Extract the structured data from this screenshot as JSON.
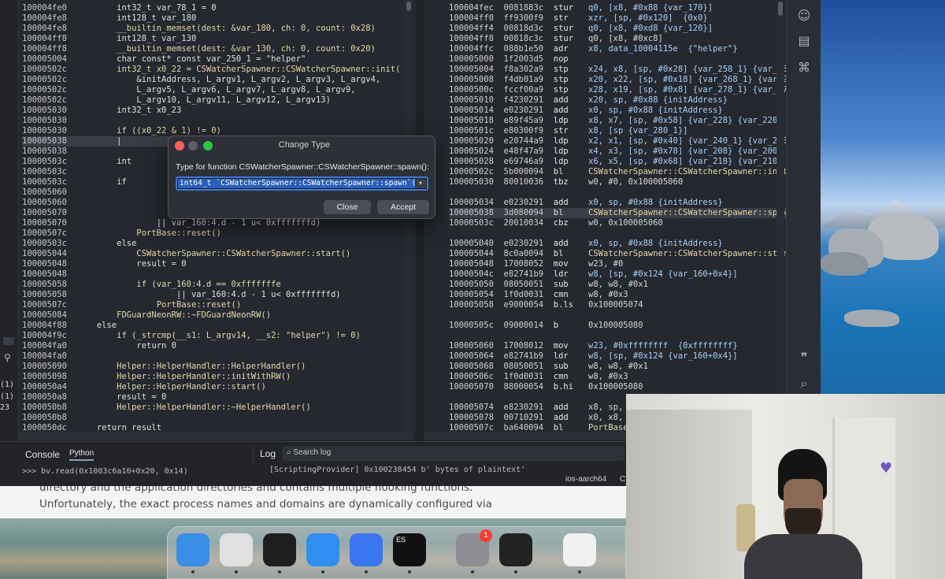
{
  "left_code": [
    {
      "addr": "100004fe0",
      "text": "        int32_t var_78_1 = 0"
    },
    {
      "addr": "100004fe8",
      "text": "        int128_t var_180"
    },
    {
      "addr": "100004fe8",
      "text": "        __builtin_memset(dest: &var_180, ch: 0, count: 0x28)"
    },
    {
      "addr": "100004ff8",
      "text": "        int128_t var_130"
    },
    {
      "addr": "100004ff8",
      "text": "        __builtin_memset(dest: &var_130, ch: 0, count: 0x20)"
    },
    {
      "addr": "100005004",
      "text": "        char const* const var_250_1 = \"helper\""
    },
    {
      "addr": "10000502c",
      "text": "        int32_t x0_22 = CSWatcherSpawner::CSWatcherSpawner::init("
    },
    {
      "addr": "10000502c",
      "text": "            &initAddress, L_argv1, L_argv2, L_argv3, L_argv4,"
    },
    {
      "addr": "10000502c",
      "text": "            L_argv5, L_argv6, L_argv7, L_argv8, L_argv9,"
    },
    {
      "addr": "10000502c",
      "text": "            L_argv10, L_argv11, L_argv12, L_argv13)"
    },
    {
      "addr": "100005030",
      "text": "        int32_t x0_23"
    },
    {
      "addr": "100005030",
      "text": ""
    },
    {
      "addr": "100005030",
      "text": "        if ((x0_22 & 1) != 0)"
    },
    {
      "addr": "100005038",
      "text": "        |",
      "hl": true
    },
    {
      "addr": "100005038",
      "text": ""
    },
    {
      "addr": "10000503c",
      "text": "        int"
    },
    {
      "addr": "10000503c",
      "text": ""
    },
    {
      "addr": "10000503c",
      "text": "        if"
    },
    {
      "addr": "100005060",
      "text": ""
    },
    {
      "addr": "100005060",
      "text": ""
    },
    {
      "addr": "100005070",
      "text": ""
    },
    {
      "addr": "100005070",
      "text": "                || var_160:4.d - 1 u< 0xfffffffd)"
    },
    {
      "addr": "10000507c",
      "text": "            PortBase::reset()"
    },
    {
      "addr": "10000503c",
      "text": "        else"
    },
    {
      "addr": "100005044",
      "text": "            CSWatcherSpawner::CSWatcherSpawner::start()"
    },
    {
      "addr": "100005048",
      "text": "            result = 0"
    },
    {
      "addr": "100005048",
      "text": ""
    },
    {
      "addr": "100005058",
      "text": "            if (var_160:4.d == 0xfffffffe"
    },
    {
      "addr": "100005058",
      "text": "                    || var_160:4.d - 1 u< 0xfffffffd)"
    },
    {
      "addr": "10000507c",
      "text": "                PortBase::reset()"
    },
    {
      "addr": "100005084",
      "text": "        FDGuardNeonRW::~FDGuardNeonRW()"
    },
    {
      "addr": "100004f88",
      "text": "    else"
    },
    {
      "addr": "100004f9c",
      "text": "        if (_strcmp(__s1: L_argv14, __s2: \"helper\") != 0)"
    },
    {
      "addr": "100004fa0",
      "text": "            return 0"
    },
    {
      "addr": "100004fa0",
      "text": ""
    },
    {
      "addr": "100005090",
      "text": "        Helper::HelperHandler::HelperHandler()"
    },
    {
      "addr": "100005098",
      "text": "        Helper::HelperHandler::initWithRW()"
    },
    {
      "addr": "1000050a4",
      "text": "        Helper::HelperHandler::start()"
    },
    {
      "addr": "1000050a8",
      "text": "        result = 0"
    },
    {
      "addr": "1000050b8",
      "text": "        Helper::HelperHandler::~HelperHandler()"
    },
    {
      "addr": "1000050b8",
      "text": ""
    },
    {
      "addr": "1000050dc",
      "text": "    return result"
    }
  ],
  "right_code": [
    {
      "addr": "100004fec",
      "hex": "0081883c",
      "op": "stur",
      "args": "q0, [x8, #0x88 {var_170}]"
    },
    {
      "addr": "100004ff0",
      "hex": "ff9300f9",
      "op": "str",
      "args": "xzr, [sp, #0x120]  {0x0}"
    },
    {
      "addr": "100004ff4",
      "hex": "00818d3c",
      "op": "stur",
      "args": "q0, [x8, #0xd8 {var_120}]"
    },
    {
      "addr": "100004ff8",
      "hex": "00818c3c",
      "op": "stur",
      "args": "q0, [x8, #0xc8]"
    },
    {
      "addr": "100004ffc",
      "hex": "088b1e50",
      "op": "adr",
      "args": "x8, data_10004115e  {\"helper\"}"
    },
    {
      "addr": "100005000",
      "hex": "1f2003d5",
      "op": "nop",
      "args": ""
    },
    {
      "addr": "100005004",
      "hex": "f8a302a9",
      "op": "stp",
      "args": "x24, x8, [sp, #0x28] {var_258_1} {var_250_1}"
    },
    {
      "addr": "100005008",
      "hex": "f4db01a9",
      "op": "stp",
      "args": "x20, x22, [sp, #0x18] {var_268_1} {var_260_1}"
    },
    {
      "addr": "10000500c",
      "hex": "fccf00a9",
      "op": "stp",
      "args": "x28, x19, [sp, #0x8] {var_278_1} {var_270_1}"
    },
    {
      "addr": "100005010",
      "hex": "f4230291",
      "op": "add",
      "args": "x20, sp, #0x88 {initAddress}"
    },
    {
      "addr": "100005014",
      "hex": "e0230291",
      "op": "add",
      "args": "x0, sp, #0x88 {initAddress}"
    },
    {
      "addr": "100005018",
      "hex": "e89f45a9",
      "op": "ldp",
      "args": "x8, x7, [sp, #0x58] {var_228} {var_220}"
    },
    {
      "addr": "10000501c",
      "hex": "e80300f9",
      "op": "str",
      "args": "x8, [sp {var_280_1}]"
    },
    {
      "addr": "100005020",
      "hex": "e20744a9",
      "op": "ldp",
      "args": "x2, x1, [sp, #0x40] {var_240_1} {var_238}"
    },
    {
      "addr": "100005024",
      "hex": "e48f47a9",
      "op": "ldp",
      "args": "x4, x3, [sp, #0x78] {var_208} {var_200}"
    },
    {
      "addr": "100005028",
      "hex": "e69746a9",
      "op": "ldp",
      "args": "x6, x5, [sp, #0x68] {var_218} {var_210}"
    },
    {
      "addr": "10000502c",
      "hex": "5b000094",
      "op": "bl",
      "args": "CSWatcherSpawner::CSWatcherSpawner::init"
    },
    {
      "addr": "100005030",
      "hex": "80010036",
      "op": "tbz",
      "args": "w0, #0, 0x100005060"
    },
    {
      "addr": "",
      "hex": "",
      "op": "",
      "args": ""
    },
    {
      "addr": "100005034",
      "hex": "e0230291",
      "op": "add",
      "args": "x0, sp, #0x88 {initAddress}"
    },
    {
      "addr": "100005038",
      "hex": "3d080094",
      "op": "bl",
      "args": "CSWatcherSpawner::CSWatcherSpawner::spawn",
      "hl": true
    },
    {
      "addr": "10000503c",
      "hex": "20010034",
      "op": "cbz",
      "args": "w0, 0x100005060"
    },
    {
      "addr": "",
      "hex": "",
      "op": "",
      "args": ""
    },
    {
      "addr": "100005040",
      "hex": "e0230291",
      "op": "add",
      "args": "x0, sp, #0x88 {initAddress}"
    },
    {
      "addr": "100005044",
      "hex": "8c0a0094",
      "op": "bl",
      "args": "CSWatcherSpawner::CSWatcherSpawner::start"
    },
    {
      "addr": "100005048",
      "hex": "17008052",
      "op": "mov",
      "args": "w23, #0"
    },
    {
      "addr": "10000504c",
      "hex": "e82741b9",
      "op": "ldr",
      "args": "w8, [sp, #0x124 {var_160+0x4}]"
    },
    {
      "addr": "100005050",
      "hex": "08050051",
      "op": "sub",
      "args": "w8, w8, #0x1"
    },
    {
      "addr": "100005054",
      "hex": "1f0d0031",
      "op": "cmn",
      "args": "w8, #0x3"
    },
    {
      "addr": "100005058",
      "hex": "e9000054",
      "op": "b.ls",
      "args": "0x100005074"
    },
    {
      "addr": "",
      "hex": "",
      "op": "",
      "args": ""
    },
    {
      "addr": "10000505c",
      "hex": "09000014",
      "op": "b",
      "args": "0x100005080"
    },
    {
      "addr": "",
      "hex": "",
      "op": "",
      "args": ""
    },
    {
      "addr": "100005060",
      "hex": "17008012",
      "op": "mov",
      "args": "w23, #0xffffffff  {0xffffffff}"
    },
    {
      "addr": "100005064",
      "hex": "e82741b9",
      "op": "ldr",
      "args": "w8, [sp, #0x124 {var_160+0x4}]"
    },
    {
      "addr": "100005068",
      "hex": "08050051",
      "op": "sub",
      "args": "w8, w8, #0x1"
    },
    {
      "addr": "10000506c",
      "hex": "1f0d0031",
      "op": "cmn",
      "args": "w8, #0x3"
    },
    {
      "addr": "100005070",
      "hex": "88000054",
      "op": "b.hi",
      "args": "0x100005080"
    },
    {
      "addr": "",
      "hex": "",
      "op": "",
      "args": ""
    },
    {
      "addr": "100005074",
      "hex": "e8230291",
      "op": "add",
      "args": "x8, sp, #"
    },
    {
      "addr": "100005078",
      "hex": "00710291",
      "op": "add",
      "args": "x0, x8, #"
    },
    {
      "addr": "10000507c",
      "hex": "ba640094",
      "op": "bl",
      "args": "PortBase::"
    }
  ],
  "dialog": {
    "title": "Change Type",
    "label": "Type for function CSWatcherSpawner::CSWatcherSpawner::spawn():",
    "input_value": "int64_t `CSWatcherSpawner::CSWatcherSpawner::spawn`()",
    "close_label": "Close",
    "accept_label": "Accept"
  },
  "bottom": {
    "console_tab": "Console",
    "python_tab": "Python",
    "log_tab": "Log",
    "log_search_placeholder": "Search log",
    "console_line": ">>> bv.read(0x1003c6a10+0x20, 0x14)",
    "log_line": "[ScriptingProvider] 0x100238454 b' bytes of plaintext'",
    "arch": "ios-aarch64",
    "arch_suffix": "C"
  },
  "sidebar_bits": [
    "(1)",
    "(1)",
    "23"
  ],
  "document": {
    "line1": "directory and the application directories and contains multiple hooking functions.",
    "line2": "Unfortunately, the exact process names and domains are dynamically configured via"
  },
  "dock": {
    "items": [
      {
        "name": "Finder",
        "color": "#3a8ee6"
      },
      {
        "name": "Privacy app",
        "color": "#e0e0e0"
      },
      {
        "name": "Terminal",
        "color": "#1e1e1e"
      },
      {
        "name": "Safari",
        "color": "#2f8ef0"
      },
      {
        "name": "Signal",
        "color": "#3a76f0"
      },
      {
        "name": "Elastic",
        "color": "#111111"
      },
      {
        "name": "System Settings",
        "color": "#8e8e93"
      },
      {
        "name": "OBS",
        "color": "#222222"
      },
      {
        "name": "Preview",
        "color": "#f0f0f0"
      }
    ],
    "badge": "1",
    "elastic_label": "ES"
  },
  "colors": {
    "accent": "#3c79d6",
    "selection": "#2a5fb8",
    "background": "#262830"
  }
}
